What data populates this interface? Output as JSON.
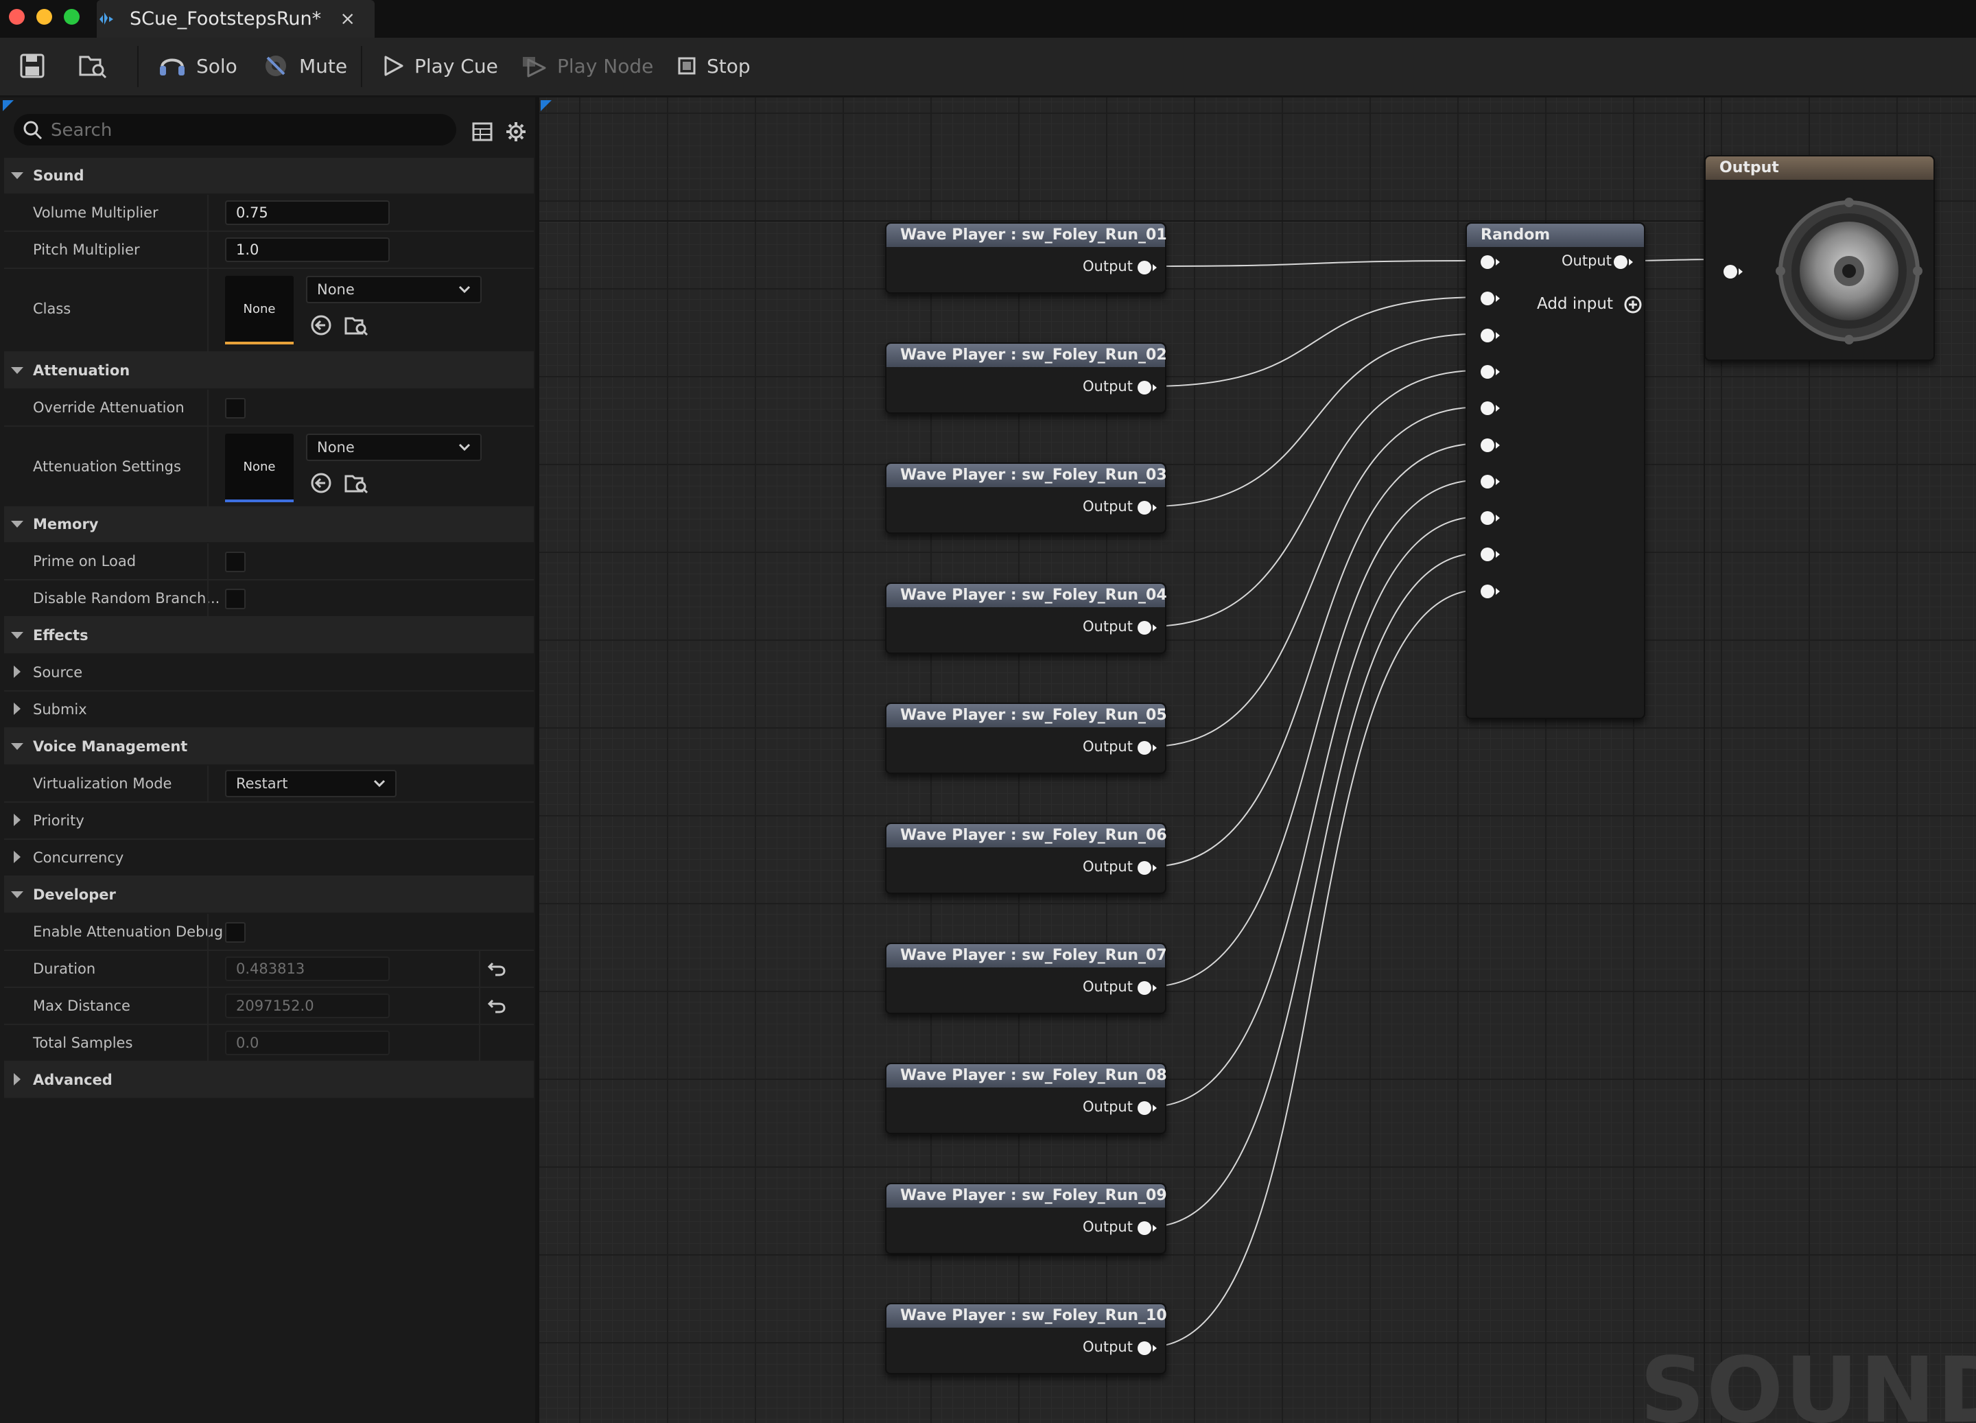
{
  "window": {
    "tab_title": "SCue_FootstepsRun*",
    "tab_close": "×",
    "traffic_colors": [
      "#ff5f57",
      "#febc2e",
      "#28c840"
    ]
  },
  "toolbar": {
    "save_icon": "save-icon",
    "browse_icon": "browse-asset-icon",
    "solo": "Solo",
    "mute": "Mute",
    "play_cue": "Play Cue",
    "play_node": "Play Node",
    "stop": "Stop"
  },
  "details": {
    "search_placeholder": "Search",
    "sections": {
      "sound": "Sound",
      "attenuation": "Attenuation",
      "memory": "Memory",
      "effects": "Effects",
      "voice_management": "Voice Management",
      "developer": "Developer",
      "advanced": "Advanced"
    },
    "props": {
      "volume_multiplier": {
        "label": "Volume Multiplier",
        "value": "0.75"
      },
      "pitch_multiplier": {
        "label": "Pitch Multiplier",
        "value": "1.0"
      },
      "class": {
        "label": "Class",
        "thumb": "None",
        "combo": "None"
      },
      "override_attenuation": {
        "label": "Override Attenuation",
        "checked": false
      },
      "attenuation_settings": {
        "label": "Attenuation Settings",
        "thumb": "None",
        "combo": "None"
      },
      "prime_on_load": {
        "label": "Prime on Load",
        "checked": false
      },
      "disable_random_branch": {
        "label": "Disable Random Branch...",
        "checked": false
      },
      "source": {
        "label": "Source"
      },
      "submix": {
        "label": "Submix"
      },
      "virtualization_mode": {
        "label": "Virtualization Mode",
        "value": "Restart"
      },
      "priority": {
        "label": "Priority"
      },
      "concurrency": {
        "label": "Concurrency"
      },
      "enable_attenuation_debug": {
        "label": "Enable Attenuation Debug",
        "checked": false
      },
      "duration": {
        "label": "Duration",
        "value": "0.483813"
      },
      "max_distance": {
        "label": "Max Distance",
        "value": "2097152.0"
      },
      "total_samples": {
        "label": "Total Samples",
        "value": "0.0"
      }
    },
    "colors": {
      "class_bar": "#e8a23a",
      "attenuation_bar": "#3d6fe0"
    }
  },
  "graph": {
    "wave_players": [
      {
        "title": "Wave Player : sw_Foley_Run_01",
        "output": "Output"
      },
      {
        "title": "Wave Player : sw_Foley_Run_02",
        "output": "Output"
      },
      {
        "title": "Wave Player : sw_Foley_Run_03",
        "output": "Output"
      },
      {
        "title": "Wave Player : sw_Foley_Run_04",
        "output": "Output"
      },
      {
        "title": "Wave Player : sw_Foley_Run_05",
        "output": "Output"
      },
      {
        "title": "Wave Player : sw_Foley_Run_06",
        "output": "Output"
      },
      {
        "title": "Wave Player : sw_Foley_Run_07",
        "output": "Output"
      },
      {
        "title": "Wave Player : sw_Foley_Run_08",
        "output": "Output"
      },
      {
        "title": "Wave Player : sw_Foley_Run_09",
        "output": "Output"
      },
      {
        "title": "Wave Player : sw_Foley_Run_10",
        "output": "Output"
      }
    ],
    "random": {
      "title": "Random",
      "output": "Output",
      "add_input": "Add input",
      "input_count": 10
    },
    "output_node": {
      "title": "Output",
      "icon": "speaker-icon"
    },
    "watermark": "SOUND CUE"
  }
}
